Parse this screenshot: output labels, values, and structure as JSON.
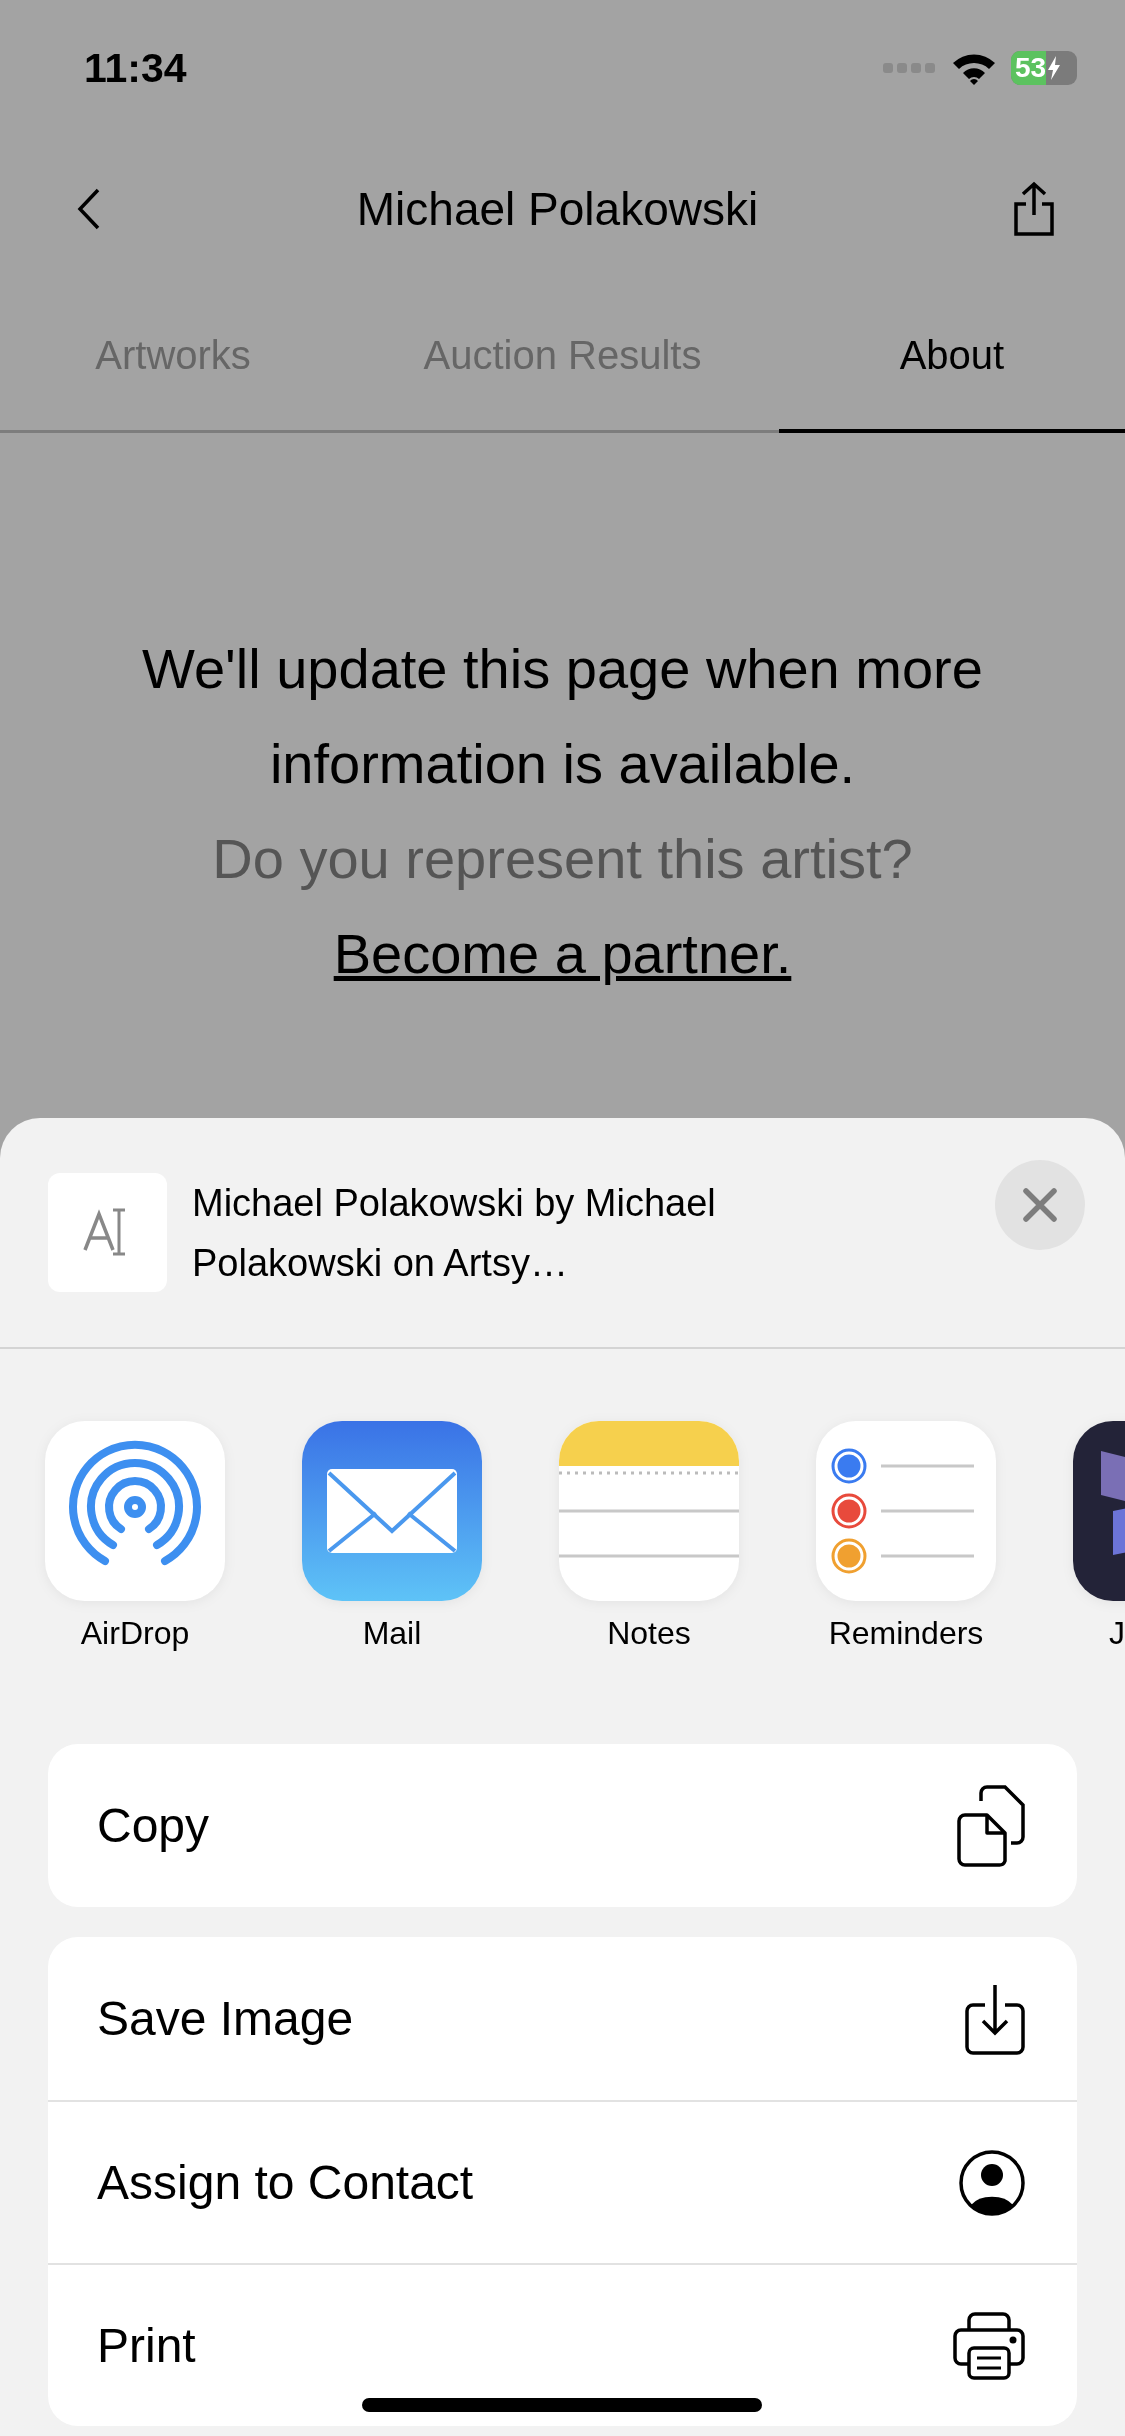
{
  "status_bar": {
    "time": "11:34",
    "battery": "53"
  },
  "nav": {
    "title": "Michael Polakowski"
  },
  "tabs": [
    {
      "label": "Artworks",
      "selected": false
    },
    {
      "label": "Auction Results",
      "selected": false
    },
    {
      "label": "About",
      "selected": true
    }
  ],
  "message": {
    "text": "We'll update this page when more information is available.",
    "question": "Do you represent this artist?",
    "link": "Become a partner."
  },
  "share_sheet": {
    "title": "Michael Polakowski by Michael Polakowski on Artsy…",
    "apps": [
      {
        "kind": "airdrop",
        "label": "AirDrop"
      },
      {
        "kind": "mail",
        "label": "Mail"
      },
      {
        "kind": "notes",
        "label": "Notes"
      },
      {
        "kind": "reminders",
        "label": "Reminders"
      },
      {
        "kind": "dark",
        "label": "J"
      }
    ],
    "action_groups": [
      [
        {
          "kind": "copy",
          "label": "Copy"
        }
      ],
      [
        {
          "kind": "save",
          "label": "Save Image"
        },
        {
          "kind": "contact",
          "label": "Assign to Contact"
        },
        {
          "kind": "print",
          "label": "Print"
        }
      ]
    ]
  }
}
